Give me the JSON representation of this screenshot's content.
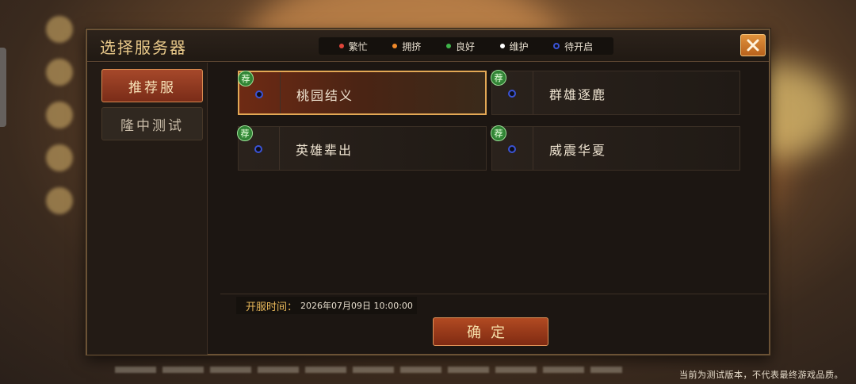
{
  "dialog": {
    "title": "选择服务器",
    "close_icon": "close-icon",
    "accent_color": "#e3a855"
  },
  "legend": [
    {
      "label": "繁忙",
      "color": "#e0453a"
    },
    {
      "label": "拥挤",
      "color": "#f08a2a"
    },
    {
      "label": "良好",
      "color": "#3fb54a"
    },
    {
      "label": "维护",
      "color": "#ffffff"
    },
    {
      "label": "待开启",
      "color": "#3a53d6"
    }
  ],
  "sidebar": {
    "tabs": [
      {
        "label": "推荐服",
        "active": true
      },
      {
        "label": "隆中测试",
        "active": false
      }
    ]
  },
  "servers": [
    {
      "name": "桃园结义",
      "badge": "荐",
      "selected": true,
      "status": "待开启"
    },
    {
      "name": "群雄逐鹿",
      "badge": "荐",
      "selected": false,
      "status": "待开启"
    },
    {
      "name": "英雄辈出",
      "badge": "荐",
      "selected": false,
      "status": "待开启"
    },
    {
      "name": "威震华夏",
      "badge": "荐",
      "selected": false,
      "status": "待开启"
    }
  ],
  "open_time": {
    "label": "开服时间：",
    "value": "2026年07月09日  10:00:00"
  },
  "confirm": {
    "label": "确定"
  },
  "footer_note": "当前为测试版本，不代表最终游戏品质。"
}
